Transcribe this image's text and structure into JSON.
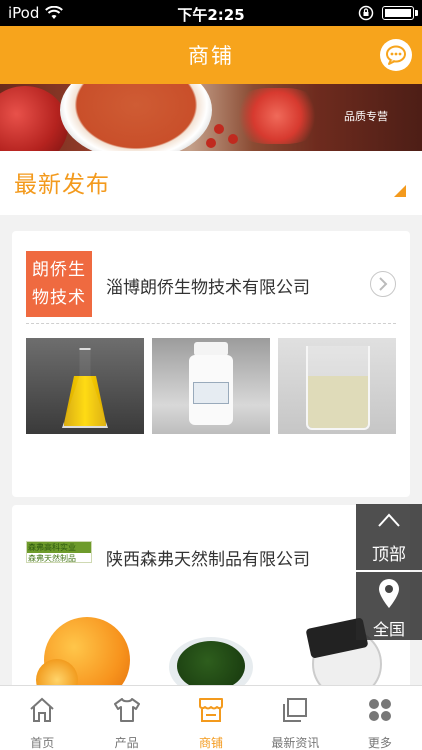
{
  "status_bar": {
    "carrier": "iPod",
    "time": "下午2:25"
  },
  "header": {
    "title": "商铺",
    "chat_icon": "chat-bubble-icon"
  },
  "banner": {
    "tag": "品质专营"
  },
  "section": {
    "title": "最新发布"
  },
  "companies": [
    {
      "logo_text": "朗侨生物技术",
      "name": "淄博朗侨生物技术有限公司"
    },
    {
      "logo_text_line1": "森弗高科实业",
      "logo_text_line2": "森弗天然制品",
      "name": "陕西森弗天然制品有限公司"
    }
  ],
  "float": {
    "top_label": "顶部",
    "all_label": "全国"
  },
  "tabs": [
    {
      "label": "首页",
      "icon": "home-icon"
    },
    {
      "label": "产品",
      "icon": "shirt-icon"
    },
    {
      "label": "商铺",
      "icon": "shop-icon",
      "active": true
    },
    {
      "label": "最新资讯",
      "icon": "news-icon"
    },
    {
      "label": "更多",
      "icon": "grid-icon"
    }
  ],
  "colors": {
    "accent": "#f7a41c",
    "text_accent": "#f39a1d"
  }
}
